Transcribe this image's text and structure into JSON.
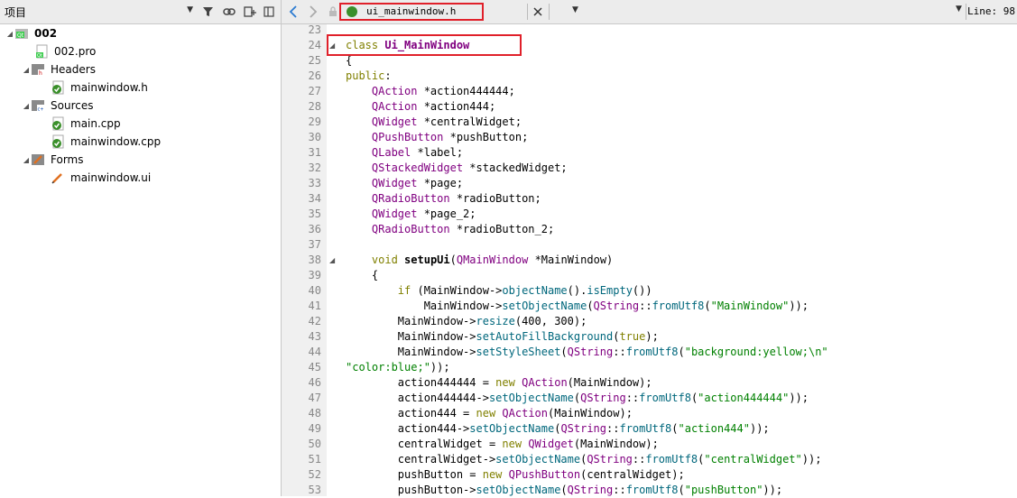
{
  "project_panel": {
    "title": "项目",
    "tree": [
      {
        "label": "002",
        "bold": true
      },
      {
        "label": "002.pro"
      },
      {
        "label": "Headers"
      },
      {
        "label": "mainwindow.h"
      },
      {
        "label": "Sources"
      },
      {
        "label": "main.cpp"
      },
      {
        "label": "mainwindow.cpp"
      },
      {
        "label": "Forms"
      },
      {
        "label": "mainwindow.ui"
      }
    ]
  },
  "editor": {
    "file": "ui_mainwindow.h",
    "line_info": "Line: 98,",
    "lines": [
      {
        "n": "23",
        "text": ""
      },
      {
        "n": "24",
        "text": "class Ui_MainWindow"
      },
      {
        "n": "25",
        "text": "{"
      },
      {
        "n": "26",
        "text": "public:"
      },
      {
        "n": "27",
        "text": "    QAction *action444444;"
      },
      {
        "n": "28",
        "text": "    QAction *action444;"
      },
      {
        "n": "29",
        "text": "    QWidget *centralWidget;"
      },
      {
        "n": "30",
        "text": "    QPushButton *pushButton;"
      },
      {
        "n": "31",
        "text": "    QLabel *label;"
      },
      {
        "n": "32",
        "text": "    QStackedWidget *stackedWidget;"
      },
      {
        "n": "33",
        "text": "    QWidget *page;"
      },
      {
        "n": "34",
        "text": "    QRadioButton *radioButton;"
      },
      {
        "n": "35",
        "text": "    QWidget *page_2;"
      },
      {
        "n": "36",
        "text": "    QRadioButton *radioButton_2;"
      },
      {
        "n": "37",
        "text": ""
      },
      {
        "n": "38",
        "text": "    void setupUi(QMainWindow *MainWindow)"
      },
      {
        "n": "39",
        "text": "    {"
      },
      {
        "n": "40",
        "text": "        if (MainWindow->objectName().isEmpty())"
      },
      {
        "n": "41",
        "text": "            MainWindow->setObjectName(QString::fromUtf8(\"MainWindow\"));"
      },
      {
        "n": "42",
        "text": "        MainWindow->resize(400, 300);"
      },
      {
        "n": "43",
        "text": "        MainWindow->setAutoFillBackground(true);"
      },
      {
        "n": "44",
        "text": "        MainWindow->setStyleSheet(QString::fromUtf8(\"background:yellow;\\n\""
      },
      {
        "n": "45",
        "text": "\"color:blue;\"));"
      },
      {
        "n": "46",
        "text": "        action444444 = new QAction(MainWindow);"
      },
      {
        "n": "47",
        "text": "        action444444->setObjectName(QString::fromUtf8(\"action444444\"));"
      },
      {
        "n": "48",
        "text": "        action444 = new QAction(MainWindow);"
      },
      {
        "n": "49",
        "text": "        action444->setObjectName(QString::fromUtf8(\"action444\"));"
      },
      {
        "n": "50",
        "text": "        centralWidget = new QWidget(MainWindow);"
      },
      {
        "n": "51",
        "text": "        centralWidget->setObjectName(QString::fromUtf8(\"centralWidget\"));"
      },
      {
        "n": "52",
        "text": "        pushButton = new QPushButton(centralWidget);"
      },
      {
        "n": "53",
        "text": "        pushButton->setObjectName(QString::fromUtf8(\"pushButton\"));"
      }
    ]
  }
}
